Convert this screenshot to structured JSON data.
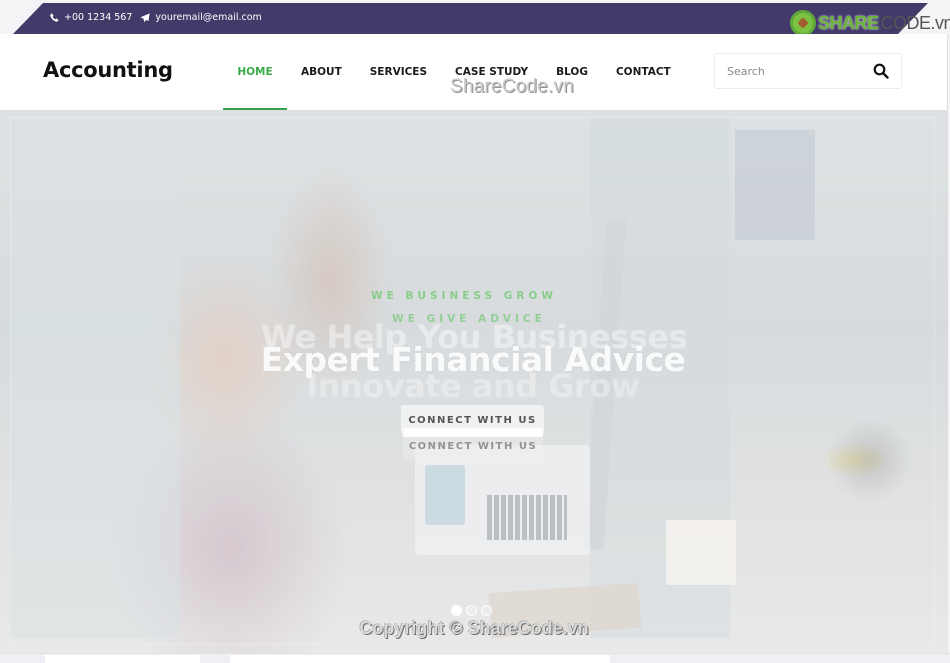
{
  "topbar": {
    "phone": "+00 1234 567",
    "email": "youremail@email.com",
    "phone_icon": "phone-icon",
    "email_icon": "paper-plane-icon",
    "background_color": "#423a69"
  },
  "watermark": {
    "logo_share": "SHARE",
    "logo_code": "CODE.vn",
    "header_text": "ShareCode.vn",
    "copyright": "Copyright © ShareCode.vn"
  },
  "header": {
    "brand": "Accounting",
    "nav": [
      {
        "label": "HOME",
        "active": true
      },
      {
        "label": "ABOUT",
        "active": false
      },
      {
        "label": "SERVICES",
        "active": false
      },
      {
        "label": "CASE STUDY",
        "active": false
      },
      {
        "label": "BLOG",
        "active": false
      },
      {
        "label": "CONTACT",
        "active": false
      }
    ],
    "search": {
      "placeholder": "Search",
      "value": "",
      "icon": "search-icon"
    },
    "accent_color": "#3aaa4a"
  },
  "hero": {
    "kicker_1": "WE BUSINESS GROW",
    "kicker_2": "WE GIVE ADVICE",
    "headline_back_1": "We Help You Businesses",
    "headline_front": "Expert Financial Advice",
    "headline_back_2": "Innovate and Grow",
    "cta_1": "CONNECT WITH US",
    "cta_2": "CONNECT WITH US",
    "slider": {
      "total_slides": 3,
      "active_index": 0
    }
  }
}
